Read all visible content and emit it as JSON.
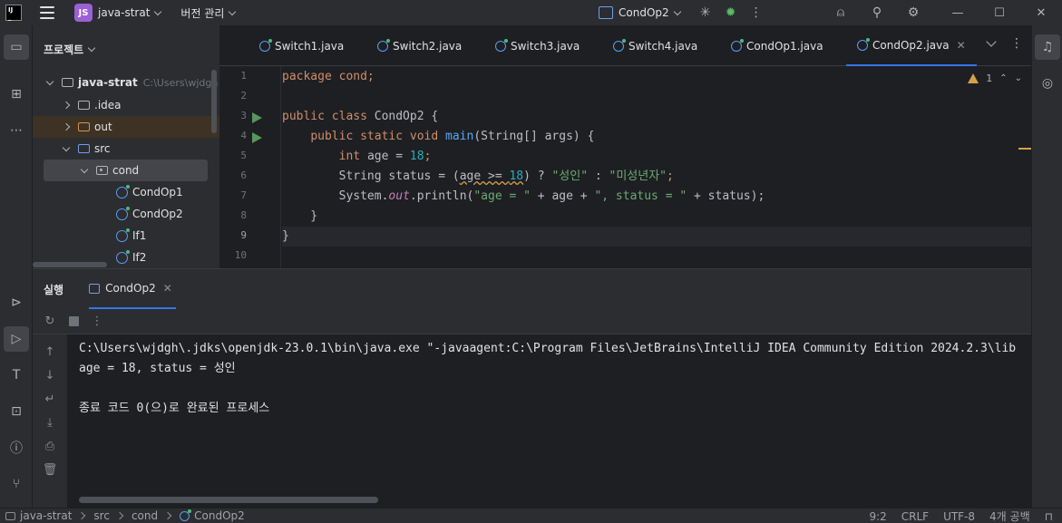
{
  "titlebar": {
    "project_badge": "JS",
    "project_name": "java-strat",
    "vcs_menu": "버전 관리",
    "run_config": "CondOp2"
  },
  "project_panel": {
    "title": "프로젝트",
    "root": "java-strat",
    "root_path": "C:\\Users\\wjdgh",
    "items": [
      {
        "label": ".idea"
      },
      {
        "label": "out"
      },
      {
        "label": "src"
      },
      {
        "label": "cond"
      },
      {
        "label": "CondOp1"
      },
      {
        "label": "CondOp2"
      },
      {
        "label": "If1"
      },
      {
        "label": "If2"
      }
    ]
  },
  "editor": {
    "tabs": [
      {
        "label": "Switch1.java"
      },
      {
        "label": "Switch2.java"
      },
      {
        "label": "Switch3.java"
      },
      {
        "label": "Switch4.java"
      },
      {
        "label": "CondOp1.java"
      },
      {
        "label": "CondOp2.java"
      }
    ],
    "warning_count": "1",
    "line_numbers": [
      "1",
      "2",
      "3",
      "4",
      "5",
      "6",
      "7",
      "8",
      "9",
      "10"
    ],
    "current_line": 9,
    "code": {
      "l1": "package cond;",
      "l3_kw": "public class ",
      "l3_id": "CondOp2 {",
      "l4_indent": "    ",
      "l4_kw": "public static void ",
      "l4_fn": "main",
      "l4_rest": "(String[] args) {",
      "l5_indent": "        ",
      "l5_kw": "int ",
      "l5_id": "age = ",
      "l5_num": "18",
      "l5_end": ";",
      "l6_indent": "        ",
      "l6_a": "String status = (",
      "l6_warn": "age >= ",
      "l6_num": "18",
      "l6_b": ") ? ",
      "l6_s1": "\"성인\"",
      "l6_c": " : ",
      "l6_s2": "\"미성년자\"",
      "l6_end": ";",
      "l7_indent": "        ",
      "l7_a": "System.",
      "l7_st": "out",
      "l7_b": ".println(",
      "l7_s1": "\"age = \"",
      "l7_c": " + age + ",
      "l7_s2": "\", status = \"",
      "l7_d": " + status);",
      "l8": "    }",
      "l9": "}"
    }
  },
  "run_panel": {
    "title": "실행",
    "tab": "CondOp2",
    "console": [
      "C:\\Users\\wjdgh\\.jdks\\openjdk-23.0.1\\bin\\java.exe \"-javaagent:C:\\Program Files\\JetBrains\\IntelliJ IDEA Community Edition 2024.2.3\\lib",
      "age = 18, status = 성인",
      "",
      "종료 코드 0(으)로 완료된 프로세스"
    ]
  },
  "statusbar": {
    "breadcrumbs": [
      "java-strat",
      "src",
      "cond",
      "CondOp2"
    ],
    "position": "9:2",
    "line_sep": "CRLF",
    "encoding": "UTF-8",
    "indent": "4개 공백"
  },
  "colors": {
    "accent": "#3574f0",
    "keyword": "#cf8e6d",
    "string": "#6aab73",
    "number": "#2aacb8",
    "function": "#56a8f5"
  }
}
